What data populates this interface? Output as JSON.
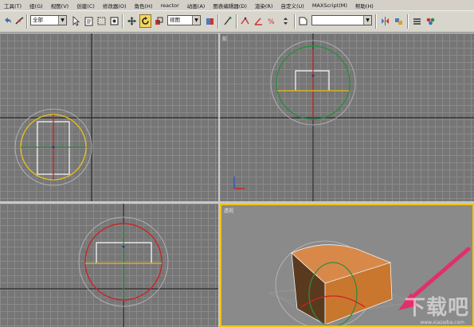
{
  "menu": [
    "工具(T)",
    "组(G)",
    "视图(V)",
    "创建(C)",
    "修改器(O)",
    "角色(H)",
    "reactor",
    "动画(A)",
    "图表编辑器(D)",
    "渲染(R)",
    "自定义(U)",
    "MAXScript(M)",
    "帮助(H)"
  ],
  "toolbar": {
    "filter_value": "全部",
    "refcoord_value": "视图",
    "named_selection_value": ""
  },
  "viewports": {
    "top_label": "",
    "front_label": "前",
    "left_label": "",
    "persp_label": "透视"
  },
  "watermark": {
    "text": "下载吧",
    "url": "www.xiazaiba.com"
  },
  "colors": {
    "viewport_bg": "#767676",
    "grid_line": "#8a8a8a",
    "active_border": "#f1c40f",
    "box_orange": "#c9772e",
    "arrow_pink": "#e0306a"
  }
}
